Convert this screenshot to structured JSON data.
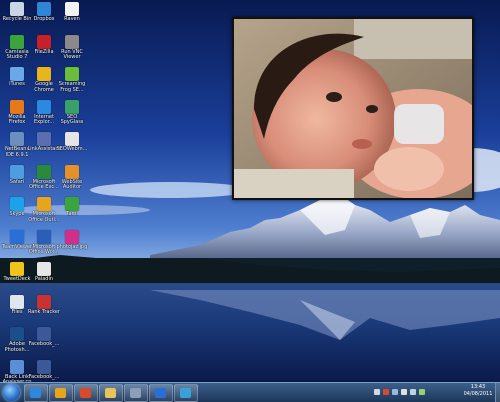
{
  "desktop": {
    "icons": [
      {
        "label": "Recycle Bin",
        "name": "recycle-bin-icon",
        "color": "#c9d6e3"
      },
      {
        "label": "Camtasia Studio 7",
        "name": "camtasia-icon",
        "color": "#3aa53a"
      },
      {
        "label": "iTunes",
        "name": "itunes-icon",
        "color": "#6aa9e8"
      },
      {
        "label": "Mozilla Firefox",
        "name": "firefox-icon",
        "color": "#e67a1a"
      },
      {
        "label": "NetBeans IDE 6.9.1",
        "name": "netbeans-icon",
        "color": "#6c8fc0"
      },
      {
        "label": "Safari",
        "name": "safari-icon",
        "color": "#4d9de0"
      },
      {
        "label": "Skype",
        "name": "skype-icon",
        "color": "#1aa3e8"
      },
      {
        "label": "TeamViewer",
        "name": "teamviewer-icon",
        "color": "#2a6fd6"
      },
      {
        "label": "TweetDeck",
        "name": "tweetdeck-icon",
        "color": "#f0c419"
      },
      {
        "label": "Files",
        "name": "files-icon",
        "color": "#dfe6ee"
      },
      {
        "label": "Adobe Photosh...",
        "name": "photoshop-icon",
        "color": "#1b4f8a"
      },
      {
        "label": "Back Link Analyser.cp",
        "name": "backlink-icon",
        "color": "#5b8ed6"
      },
      {
        "label": "Dropbox",
        "name": "dropbox-icon",
        "color": "#2f86d6"
      },
      {
        "label": "FileZilla",
        "name": "filezilla-icon",
        "color": "#c8202a"
      },
      {
        "label": "Google Chrome",
        "name": "chrome-icon",
        "color": "#e8b51a"
      },
      {
        "label": "Internet Explor...",
        "name": "ie-icon",
        "color": "#2b8ae0"
      },
      {
        "label": "LinkAssistant",
        "name": "linkassistant-icon",
        "color": "#5b6fb0"
      },
      {
        "label": "Microsoft Office Exc...",
        "name": "excel-icon",
        "color": "#2a8a3a"
      },
      {
        "label": "Microsoft Office Outl...",
        "name": "outlook-icon",
        "color": "#e6a51a"
      },
      {
        "label": "Microsoft Office Wor...",
        "name": "word-icon",
        "color": "#2a5fb5"
      },
      {
        "label": "Paladin",
        "name": "paladin-icon",
        "color": "#e6e6e6"
      },
      {
        "label": "Rank Tracker",
        "name": "rank-tracker-icon",
        "color": "#c83232"
      },
      {
        "label": "Facebook_...",
        "name": "facebook-file-icon",
        "color": "#3b5998"
      },
      {
        "label": "Facebook_...",
        "name": "facebook-file-2-icon",
        "color": "#3b5998"
      },
      {
        "label": "Raven",
        "name": "raven-icon",
        "color": "#f2f2f2"
      },
      {
        "label": "Run VNC Viewer",
        "name": "vnc-icon",
        "color": "#8a8a8a"
      },
      {
        "label": "Screaming Frog SE...",
        "name": "screaming-frog-icon",
        "color": "#6abf3a"
      },
      {
        "label": "SEO SpyGlass",
        "name": "seo-spyglass-icon",
        "color": "#3aa06a"
      },
      {
        "label": "SEOWebm...",
        "name": "seowebmaster-icon",
        "color": "#e6e6e6"
      },
      {
        "label": "WebSite Auditor",
        "name": "website-auditor-icon",
        "color": "#e6902a"
      },
      {
        "label": "Tami",
        "name": "tami-icon",
        "color": "#3aa53a"
      },
      {
        "label": "photojaz.jpg",
        "name": "photo-file-icon",
        "color": "#d0308a"
      }
    ]
  },
  "taskbar": {
    "start": "start-button",
    "pinned": [
      {
        "name": "taskbar-ie",
        "color": "#2b8ae0"
      },
      {
        "name": "taskbar-media",
        "color": "#e6a51a"
      },
      {
        "name": "taskbar-chrome",
        "color": "#d84a2a"
      },
      {
        "name": "taskbar-explorer",
        "color": "#e8c25a"
      },
      {
        "name": "taskbar-app",
        "color": "#8aa0b8"
      },
      {
        "name": "taskbar-outlook",
        "color": "#2a6fd6"
      },
      {
        "name": "taskbar-app-2",
        "color": "#3aa0d6"
      }
    ],
    "clock": {
      "time": "13:43",
      "date": "04/08/2011"
    }
  }
}
